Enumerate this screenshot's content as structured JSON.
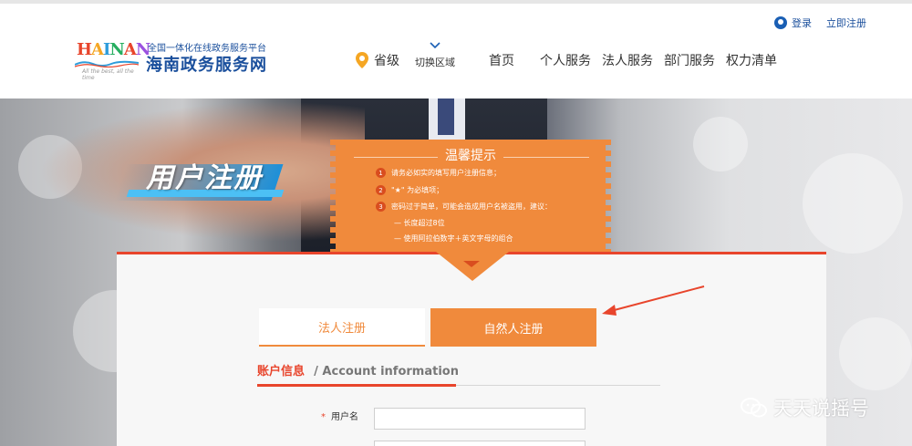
{
  "header": {
    "auth": {
      "login": "登录",
      "register": "立即注册"
    },
    "logo": {
      "text": "HAINAN",
      "slogan": "All the best, all the time"
    },
    "site_subtitle": "全国一体化在线政务服务平台",
    "site_title": "海南政务服务网",
    "region": {
      "label": "省级",
      "switch": "切换区域"
    },
    "nav": [
      "首页",
      "个人服务",
      "法人服务",
      "部门服务",
      "权力清单"
    ]
  },
  "banner": {
    "title": "用户注册",
    "notice": {
      "title": "温馨提示",
      "items": [
        {
          "num": "1",
          "text": "请务必如实的填写用户注册信息；"
        },
        {
          "num": "2",
          "text": "\"★\" 为必填项；"
        },
        {
          "num": "3",
          "text": "密码过于简单，可能会造成用户名被盗用，建议："
        }
      ],
      "sub_items": [
        "— 长度超过8位",
        "— 使用阿拉伯数字＋英文字母的组合"
      ]
    }
  },
  "form": {
    "tabs": {
      "legal": "法人注册",
      "natural": "自然人注册",
      "active": "natural"
    },
    "section": {
      "cn": "账户信息",
      "en": "/ Account information"
    },
    "fields": [
      {
        "required_mark": "*",
        "label": "用户名",
        "value": ""
      }
    ]
  },
  "watermark": "天天说摇号",
  "colors": {
    "accent_orange": "#f08a3c",
    "accent_red": "#e8452c",
    "brand_blue": "#1a4f9c"
  }
}
